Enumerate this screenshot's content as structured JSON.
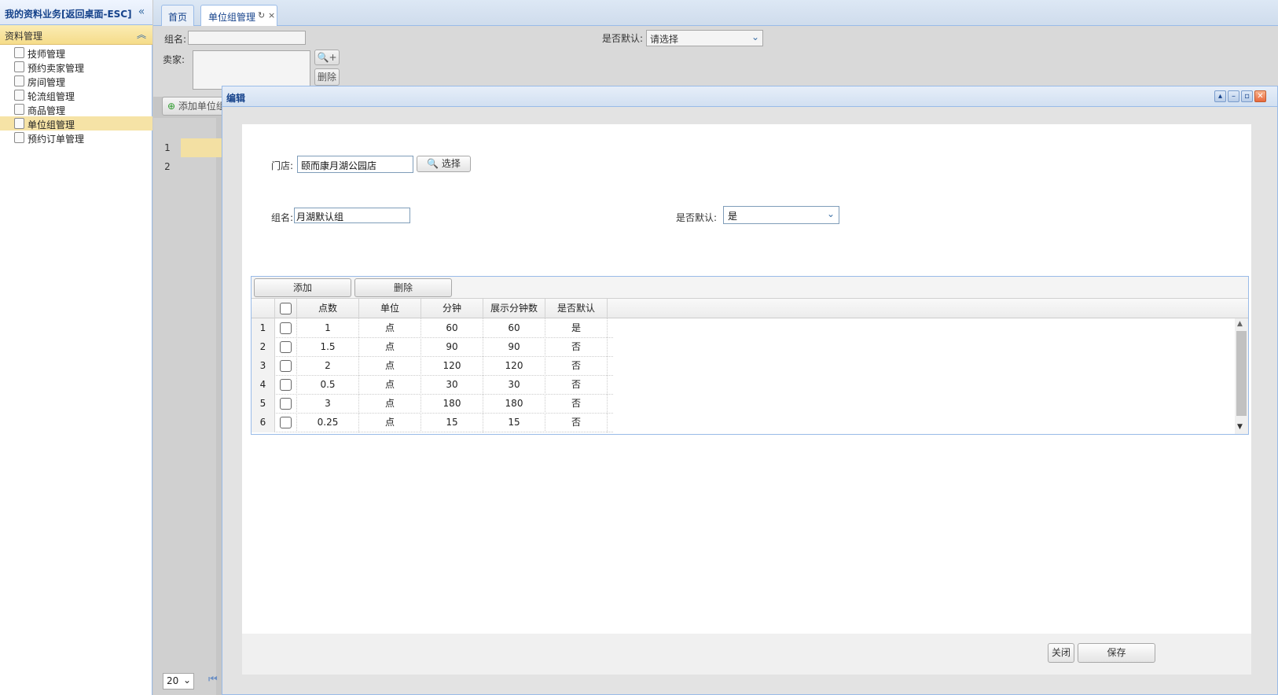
{
  "sidebar": {
    "title": "我的资料业务[返回桌面-ESC]",
    "group": "资料管理",
    "items": [
      {
        "label": "技师管理"
      },
      {
        "label": "预约卖家管理"
      },
      {
        "label": "房间管理"
      },
      {
        "label": "轮流组管理"
      },
      {
        "label": "商品管理"
      },
      {
        "label": "单位组管理"
      },
      {
        "label": "预约订单管理"
      }
    ]
  },
  "tabs": {
    "home": "首页",
    "active": "单位组管理"
  },
  "search": {
    "group_label": "组名:",
    "default_label": "是否默认:",
    "default_placeholder": "请选择",
    "seller_label": "卖家:",
    "delete_label": "删除",
    "add_unit_label": "添加单位组"
  },
  "bg_grid": {
    "rows": [
      "1",
      "2"
    ],
    "page_size": "20"
  },
  "dialog": {
    "title": "编辑",
    "store_label": "门店:",
    "store_value": "颐而康月湖公园店",
    "select_button": "选择",
    "group_label": "组名:",
    "group_value": "月湖默认组",
    "default_label": "是否默认:",
    "default_value": "是",
    "add_button": "添加",
    "delete_button": "删除",
    "columns": [
      "点数",
      "单位",
      "分钟",
      "展示分钟数",
      "是否默认"
    ],
    "rows": [
      {
        "n": "1",
        "points": "1",
        "unit": "点",
        "minutes": "60",
        "display": "60",
        "default": "是"
      },
      {
        "n": "2",
        "points": "1.5",
        "unit": "点",
        "minutes": "90",
        "display": "90",
        "default": "否"
      },
      {
        "n": "3",
        "points": "2",
        "unit": "点",
        "minutes": "120",
        "display": "120",
        "default": "否"
      },
      {
        "n": "4",
        "points": "0.5",
        "unit": "点",
        "minutes": "30",
        "display": "30",
        "default": "否"
      },
      {
        "n": "5",
        "points": "3",
        "unit": "点",
        "minutes": "180",
        "display": "180",
        "default": "否"
      },
      {
        "n": "6",
        "points": "0.25",
        "unit": "点",
        "minutes": "15",
        "display": "15",
        "default": "否"
      }
    ],
    "close_button": "关闭",
    "save_button": "保存"
  }
}
